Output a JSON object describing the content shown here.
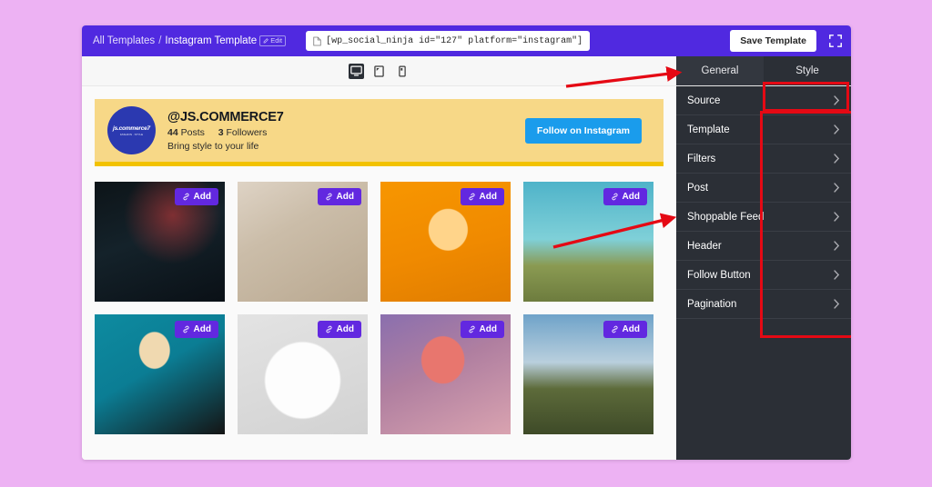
{
  "page": {
    "background_color": "#edb2f3"
  },
  "topbar": {
    "background_color": "#5029e0",
    "breadcrumb_root": "All Templates",
    "breadcrumb_sep": "/",
    "breadcrumb_current": "Instagram Template",
    "edit_badge_label": "Edit",
    "shortcode": "[wp_social_ninja id=\"127\" platform=\"instagram\"]",
    "save_label": "Save Template",
    "fullscreen_icon": "fullscreen-icon"
  },
  "device_switch": {
    "options": [
      {
        "name": "desktop",
        "icon": "desktop-icon",
        "active": true
      },
      {
        "name": "tablet",
        "icon": "tablet-icon",
        "active": false
      },
      {
        "name": "mobile",
        "icon": "mobile-icon",
        "active": false
      }
    ]
  },
  "tabs": [
    {
      "label": "General",
      "active": true
    },
    {
      "label": "Style",
      "active": false
    }
  ],
  "profile": {
    "handle": "@JS.COMMERCE7",
    "posts_count": "44",
    "posts_label": "Posts",
    "followers_count": "3",
    "followers_label": "Followers",
    "bio": "Bring style to your life",
    "follow_button_label": "Follow on Instagram",
    "avatar_text": "js.commerce7",
    "avatar_subtext": "FASHION · STYLE",
    "background_color": "#f7d887",
    "accent_color": "#f2c200"
  },
  "feed": {
    "add_badge_label": "Add",
    "add_badge_icon": "link-icon",
    "add_badge_color": "#6228e0",
    "items": [
      {
        "alt": "man-in-green-shirt-dark-portrait"
      },
      {
        "alt": "woman-leaning-on-table-neutral-tones"
      },
      {
        "alt": "woman-in-yellow-orange-duotone"
      },
      {
        "alt": "woman-in-white-dress-with-suitcase-blue-sky"
      },
      {
        "alt": "woman-in-red-shirt-sunglasses-teal-background"
      },
      {
        "alt": "white-knit-sweater-on-grey-background"
      },
      {
        "alt": "woman-in-pink-off-shoulder-purple-light"
      },
      {
        "alt": "couple-on-boat-in-field-cloudy-sky"
      }
    ]
  },
  "settings_panel": {
    "background_color": "#2b2f36",
    "items": [
      {
        "label": "Source",
        "icon": "chevron-right-icon"
      },
      {
        "label": "Template",
        "icon": "chevron-right-icon"
      },
      {
        "label": "Filters",
        "icon": "chevron-right-icon"
      },
      {
        "label": "Post",
        "icon": "chevron-right-icon"
      },
      {
        "label": "Shoppable Feed",
        "icon": "chevron-right-icon"
      },
      {
        "label": "Header",
        "icon": "chevron-right-icon"
      },
      {
        "label": "Follow Button",
        "icon": "chevron-right-icon"
      },
      {
        "label": "Pagination",
        "icon": "chevron-right-icon"
      }
    ]
  },
  "annotations": {
    "highlight_color": "#e50914",
    "boxes": [
      "general-tab",
      "settings-list"
    ],
    "arrows": [
      "arrow-to-general-tab",
      "arrow-to-settings-list"
    ]
  }
}
